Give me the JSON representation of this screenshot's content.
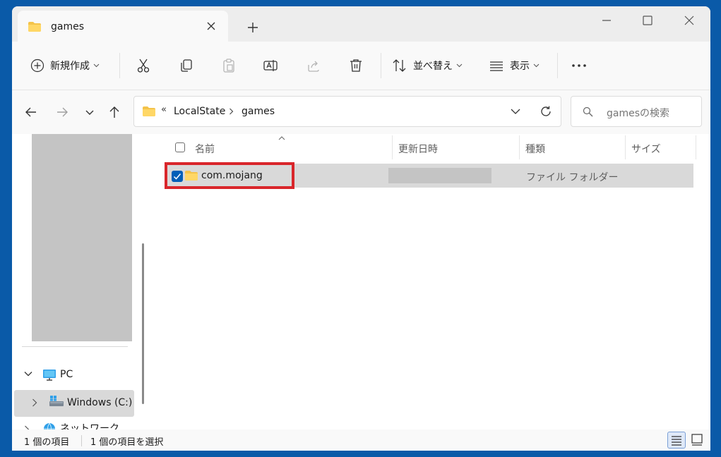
{
  "window": {
    "tab_title": "games"
  },
  "toolbar": {
    "new_label": "新規作成",
    "sort_label": "並べ替え",
    "view_label": "表示"
  },
  "nav": {
    "path_prefix": "«",
    "path": [
      "LocalState",
      "games"
    ],
    "search_placeholder": "gamesの検索"
  },
  "sidebar": {
    "items": [
      {
        "label": "PC",
        "icon": "pc-icon",
        "expanded": true
      },
      {
        "label": "Windows (C:)",
        "icon": "drive-icon",
        "selected": true
      },
      {
        "label": "ネットワーク",
        "icon": "network-icon"
      }
    ]
  },
  "file_list": {
    "columns": [
      "名前",
      "更新日時",
      "種類",
      "サイズ"
    ],
    "rows": [
      {
        "name": "com.mojang",
        "modified": "",
        "type": "ファイル フォルダー",
        "size": "",
        "checked": true
      }
    ]
  },
  "status": {
    "count": "1 個の項目",
    "selected": "1 個の項目を選択"
  },
  "colors": {
    "accent": "#005fb8",
    "highlight": "#d9262b",
    "folder": "#f4c34a"
  }
}
